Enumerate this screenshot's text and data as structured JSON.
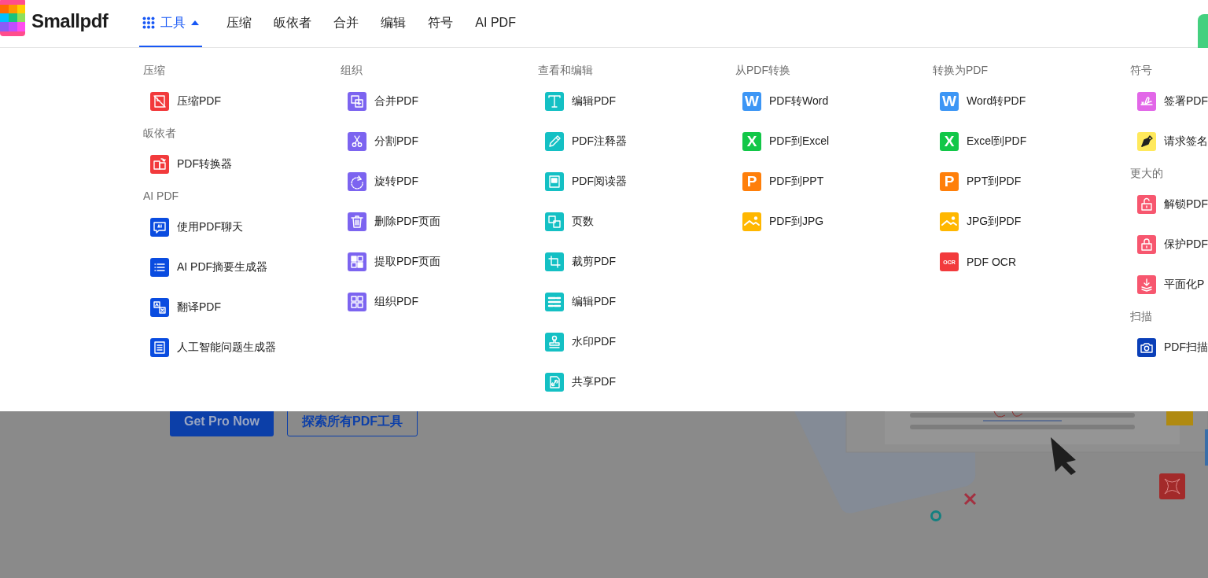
{
  "header": {
    "logo": "Smallpdf",
    "nav": [
      {
        "label": "工具",
        "kind": "menu",
        "selected": true,
        "expanded": true
      },
      {
        "label": "压缩",
        "kind": "link",
        "selected": false
      },
      {
        "label": "皈依者",
        "kind": "link",
        "selected": false
      },
      {
        "label": "合并",
        "kind": "link",
        "selected": false
      },
      {
        "label": "编辑",
        "kind": "link",
        "selected": false
      },
      {
        "label": "符号",
        "kind": "link",
        "selected": false
      },
      {
        "label": "AI PDF",
        "kind": "link",
        "selected": false
      }
    ]
  },
  "menu": {
    "columns": [
      {
        "sections": [
          {
            "heading": "压缩",
            "items": [
              {
                "label": "压缩PDF",
                "color": "#f23a3c"
              }
            ]
          },
          {
            "heading": "皈依者",
            "items": [
              {
                "label": "PDF转换器",
                "color": "#f23a3c"
              }
            ]
          },
          {
            "heading": "AI PDF",
            "items": [
              {
                "label": "使用PDF聊天",
                "color": "#0a4ce0"
              },
              {
                "label": "AI PDF摘要生成器",
                "color": "#0a4ce0"
              },
              {
                "label": "翻译PDF",
                "color": "#0a4ce0"
              },
              {
                "label": "人工智能问题生成器",
                "color": "#0a4ce0"
              }
            ]
          }
        ]
      },
      {
        "sections": [
          {
            "heading": "组织",
            "items": [
              {
                "label": "合并PDF",
                "color": "#7c64f0"
              },
              {
                "label": "分割PDF",
                "color": "#7c64f0"
              },
              {
                "label": "旋转PDF",
                "color": "#7c64f0"
              },
              {
                "label": "删除PDF页面",
                "color": "#7c64f0"
              },
              {
                "label": "提取PDF页面",
                "color": "#7c64f0"
              },
              {
                "label": "组织PDF",
                "color": "#7c64f0"
              }
            ]
          }
        ]
      },
      {
        "sections": [
          {
            "heading": "查看和编辑",
            "items": [
              {
                "label": "编辑PDF",
                "color": "#14c0c4"
              },
              {
                "label": "PDF注释器",
                "color": "#14c0c4"
              },
              {
                "label": "PDF阅读器",
                "color": "#14c0c4"
              },
              {
                "label": "页数",
                "color": "#14c0c4"
              },
              {
                "label": "裁剪PDF",
                "color": "#14c0c4"
              },
              {
                "label": "编辑PDF",
                "color": "#14c0c4"
              },
              {
                "label": "水印PDF",
                "color": "#14c0c4"
              },
              {
                "label": "共享PDF",
                "color": "#14c0c4"
              }
            ]
          }
        ]
      },
      {
        "sections": [
          {
            "heading": "从PDF转换",
            "items": [
              {
                "label": "PDF转Word",
                "color": "#3d96f5",
                "glyph": "W"
              },
              {
                "label": "PDF到Excel",
                "color": "#12c748",
                "glyph": "X"
              },
              {
                "label": "PDF到PPT",
                "color": "#ff7f0a",
                "glyph": "P"
              },
              {
                "label": "PDF到JPG",
                "color": "#ffb700"
              }
            ]
          }
        ]
      },
      {
        "sections": [
          {
            "heading": "转换为PDF",
            "items": [
              {
                "label": "Word转PDF",
                "color": "#3d96f5",
                "glyph": "W"
              },
              {
                "label": "Excel到PDF",
                "color": "#12c748",
                "glyph": "X"
              },
              {
                "label": "PPT到PDF",
                "color": "#ff7f0a",
                "glyph": "P"
              },
              {
                "label": "JPG到PDF",
                "color": "#ffb700"
              },
              {
                "label": "PDF OCR",
                "color": "#f23a3c",
                "glyph": "OCR"
              }
            ]
          }
        ]
      },
      {
        "sections": [
          {
            "heading": "符号",
            "items": [
              {
                "label": "签署PDF",
                "color": "#e267e8"
              },
              {
                "label": "请求签名",
                "color": "#ffe95c"
              }
            ]
          },
          {
            "heading": "更大的",
            "items": [
              {
                "label": "解锁PDF",
                "color": "#f7576f"
              },
              {
                "label": "保护PDF",
                "color": "#f7576f"
              },
              {
                "label": "平面化P",
                "color": "#f7576f"
              }
            ]
          },
          {
            "heading": "扫描",
            "items": [
              {
                "label": "PDF扫描",
                "color": "#0a3fb8"
              }
            ]
          }
        ]
      }
    ]
  },
  "hero": {
    "buttons": [
      {
        "label": "Get Pro Now",
        "kind": "primary"
      },
      {
        "label": "探索所有PDF工具",
        "kind": "outline"
      }
    ]
  }
}
